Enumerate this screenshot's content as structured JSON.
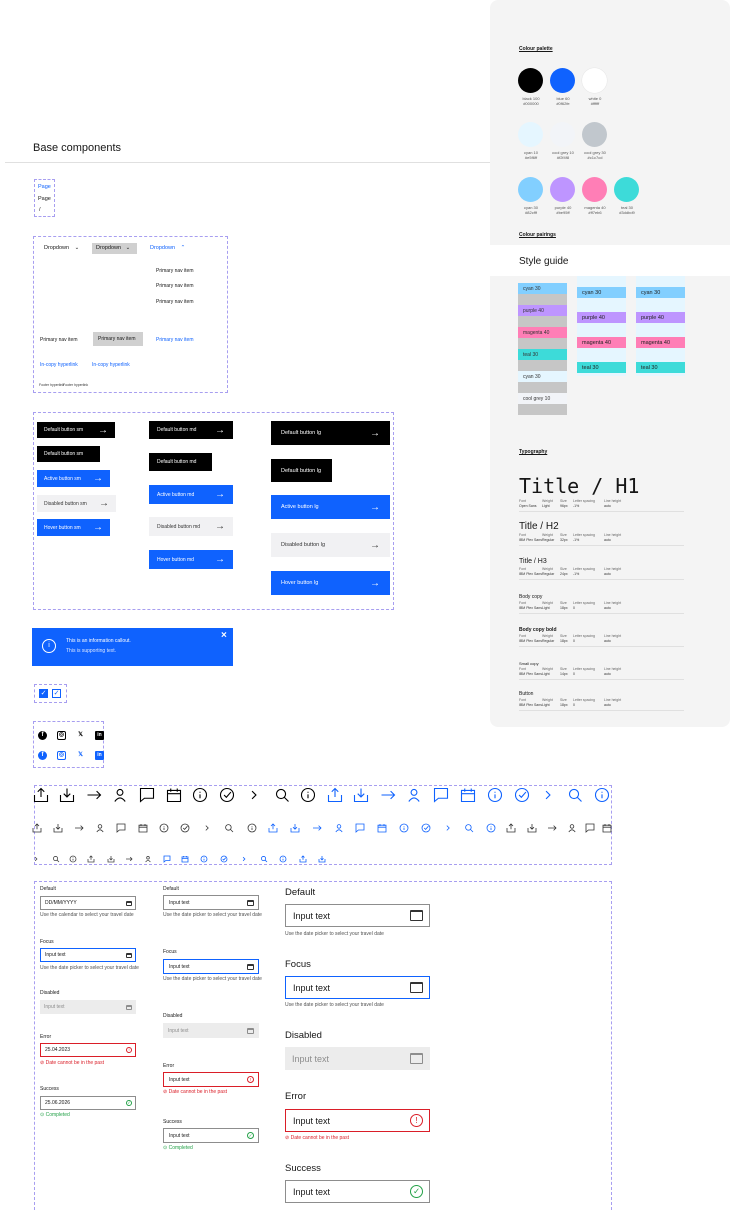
{
  "left": {
    "section_title": "Base components",
    "breadcrumb": [
      "Page",
      "Page",
      "/"
    ],
    "nav": {
      "dropdowns": [
        "Dropdown",
        "Dropdown",
        "Dropdown"
      ],
      "menu_items": [
        "Primary nav item",
        "Primary nav item",
        "Primary nav item"
      ],
      "nav_items": [
        "Primary nav item",
        "Primary nav item",
        "Primary nav item"
      ],
      "links": [
        "In-copy hyperlink",
        "In-copy hyperlink"
      ],
      "footer_links": [
        "Footer hyperlink",
        "Footer hyperlink"
      ]
    },
    "buttons": {
      "sm": [
        "Default button sm",
        "Default button sm",
        "Active button sm",
        "Disabled button sm",
        "Hover button sm"
      ],
      "md": [
        "Default button md",
        "Default button md",
        "Active button md",
        "Disabled button md",
        "Hover button md"
      ],
      "lg": [
        "Default button lg",
        "Default button lg",
        "Active button lg",
        "Disabled button lg",
        "Hover button lg"
      ],
      "arrow": "→"
    },
    "callout": {
      "title": "This is an information callout.",
      "text": "This is supporting text.",
      "close": "×",
      "info": "i"
    },
    "social": [
      "facebook-icon",
      "instagram-icon",
      "x-icon",
      "linkedin-icon"
    ],
    "date_sm": {
      "default_label": "Default",
      "default_value": "DD/MM/YYYY",
      "default_help": "Use the calendar to select your travel date",
      "focus_label": "Focus",
      "focus_value": "Input text",
      "focus_help": "Use the date picker to select your travel date",
      "disabled_label": "Disabled",
      "disabled_value": "Input text",
      "error_label": "Error",
      "error_value": "25.04.2023",
      "error_help": "Date cannot be in the past",
      "success_label": "Success",
      "success_value": "25.06.2026",
      "success_help": "Completed"
    },
    "date_md": {
      "default_label": "Default",
      "default_value": "Input text",
      "default_help": "Use the date picker to select your travel date",
      "focus_label": "Focus",
      "focus_value": "Input text",
      "focus_help": "Use the date picker to select your travel date",
      "disabled_label": "Disabled",
      "disabled_value": "Input text",
      "error_label": "Error",
      "error_value": "Input text",
      "error_help": "Date cannot be in the past",
      "success_label": "Success",
      "success_value": "Input text",
      "success_help": "Completed"
    },
    "date_lg": {
      "default_label": "Default",
      "default_value": "Input text",
      "default_help": "Use the date picker to select your travel date",
      "focus_label": "Focus",
      "focus_value": "Input text",
      "focus_help": "Use the date picker to select your travel date",
      "disabled_label": "Disabled",
      "disabled_value": "Input text",
      "error_label": "Error",
      "error_value": "Input text",
      "error_help": "Date cannot be in the past",
      "success_label": "Success",
      "success_value": "Input text",
      "success_help": "Completed"
    }
  },
  "right": {
    "palette_title": "Colour palette",
    "palette": [
      {
        "name": "black 100",
        "hex": "#000000",
        "color": "#000000"
      },
      {
        "name": "blue 60",
        "hex": "#0f62fe",
        "color": "#0f62fe"
      },
      {
        "name": "white 0",
        "hex": "#ffffff",
        "color": "#ffffff"
      },
      {
        "name": "cyan 10",
        "hex": "#e5f6ff",
        "color": "#e5f6ff"
      },
      {
        "name": "cool grey 10",
        "hex": "#f2f4f8",
        "color": "#f2f4f8"
      },
      {
        "name": "cool grey 30",
        "hex": "#c1c7cd",
        "color": "#c1c7cd"
      },
      {
        "name": "cyan 30",
        "hex": "#82cfff",
        "color": "#82cfff"
      },
      {
        "name": "purple 40",
        "hex": "#be95ff",
        "color": "#be95ff"
      },
      {
        "name": "magenta 40",
        "hex": "#ff7eb6",
        "color": "#ff7eb6"
      },
      {
        "name": "teal 30",
        "hex": "#3ddbd9",
        "color": "#3ddbd9"
      }
    ],
    "pairings_title": "Colour pairings",
    "style_guide": "Style guide",
    "pair_col1": [
      "cyan 30",
      "",
      "purple 40",
      "",
      "magenta 40",
      "",
      "teal 30",
      "",
      "cyan 30",
      "",
      "cool grey 10"
    ],
    "pair_col2": [
      "cyan 30",
      "purple 40",
      "magenta 40",
      "teal 30"
    ],
    "pair_col3": [
      "cyan 30",
      "purple 40",
      "magenta 40",
      "teal 30"
    ],
    "typography_title": "Typography",
    "type_keys": [
      "Font",
      "Weight",
      "Size",
      "Letter spacing",
      "Line height"
    ],
    "type_rows": [
      {
        "sample": "Title / H1",
        "font": "Open Sans",
        "weight": "Light",
        "size": "96px",
        "ls": "-1%",
        "lh": "auto"
      },
      {
        "sample": "Title / H2",
        "font": "IBM Plex Sans",
        "weight": "Regular",
        "size": "32px",
        "ls": "-1%",
        "lh": "auto"
      },
      {
        "sample": "Title / H3",
        "font": "IBM Plex Sans",
        "weight": "Regular",
        "size": "24px",
        "ls": "-1%",
        "lh": "auto"
      },
      {
        "sample": "Body copy",
        "font": "IBM Plex Sans",
        "weight": "Light",
        "size": "18px",
        "ls": "0",
        "lh": "auto"
      },
      {
        "sample": "Body copy bold",
        "font": "IBM Plex Sans",
        "weight": "Regular",
        "size": "18px",
        "ls": "0",
        "lh": "auto"
      },
      {
        "sample": "Small copy",
        "font": "IBM Plex Sans",
        "weight": "Light",
        "size": "14px",
        "ls": "0",
        "lh": "auto"
      },
      {
        "sample": "Button",
        "font": "IBM Plex Sans",
        "weight": "Light",
        "size": "18px",
        "ls": "0",
        "lh": "auto"
      }
    ]
  }
}
